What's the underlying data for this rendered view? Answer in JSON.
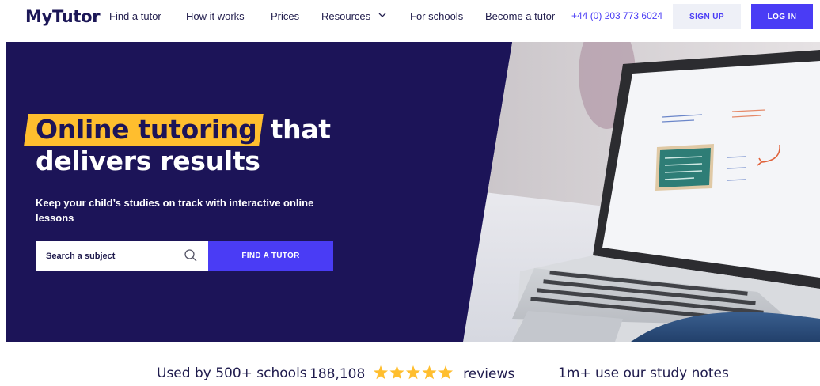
{
  "header": {
    "logo": "MyTutor",
    "nav": [
      {
        "label": "Find a tutor"
      },
      {
        "label": "How it works"
      },
      {
        "label": "Prices"
      },
      {
        "label": "Resources"
      },
      {
        "label": "For schools"
      },
      {
        "label": "Become a tutor"
      }
    ],
    "phone": "+44 (0) 203 773 6024",
    "signup_label": "SIGN UP",
    "login_label": "LOG IN"
  },
  "hero": {
    "headline_highlight": "Online tutoring",
    "headline_rest1": "that",
    "headline_rest2": "delivers results",
    "subtitle": "Keep your child’s studies on track with interactive online lessons",
    "search_placeholder": "Search a subject",
    "find_button": "FIND A TUTOR"
  },
  "stats": {
    "schools": "Used by 500+ schools",
    "reviews_count": "188,108",
    "reviews_label": "reviews",
    "rating_stars": 5,
    "notes": "1m+ use our study notes"
  },
  "colors": {
    "brand": "#4a3cf5",
    "hero_bg": "#1c1458",
    "highlight": "#ffbe2e",
    "star": "#ffbe2e"
  }
}
